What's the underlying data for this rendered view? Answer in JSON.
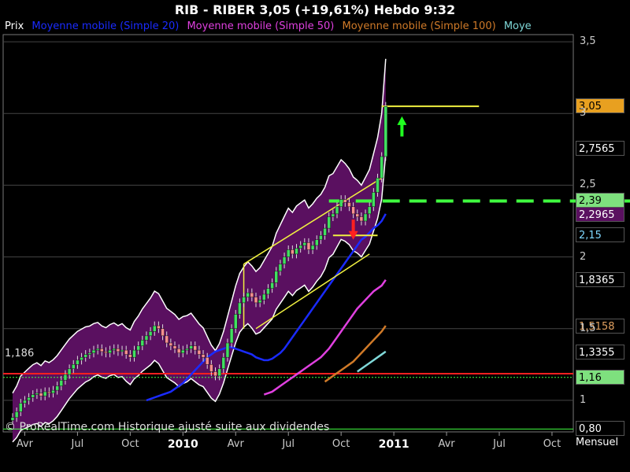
{
  "title": "RIB - RIBER     3,05 (+19,61%)     Hebdo  9:32",
  "legend": {
    "prix": "Prix",
    "ma20": "Moyenne mobile (Simple 20)",
    "ma50": "Moyenne mobile (Simple 50)",
    "ma100": "Moyenne mobile (Simple 100)",
    "ma200": "Moye"
  },
  "colors": {
    "ma20": "#1a2bff",
    "ma50": "#e040e0",
    "ma100": "#d07a28",
    "ma200": "#7fd8d8",
    "bollinger_fill": "#5a1060",
    "resistance": "#ff2020",
    "support": "#40ff40",
    "channel": "#f0f040",
    "bull_candle": "#40e060",
    "bear_candle": "#ff9090"
  },
  "price_tags": [
    {
      "label": "3,05",
      "bg": "#e8a020",
      "fg": "#000000",
      "value": 3.05
    },
    {
      "label": "2,7565",
      "bg": "#000000",
      "fg": "#ffffff",
      "value": 2.7565
    },
    {
      "label": "2,39",
      "bg": "#7ee07e",
      "fg": "#000000",
      "value": 2.39
    },
    {
      "label": "2,2965",
      "bg": "#5a1060",
      "fg": "#ffffff",
      "value": 2.2965
    },
    {
      "label": "2,15",
      "bg": "#000000",
      "fg": "#7fd8ff",
      "value": 2.15
    },
    {
      "label": "1,8365",
      "bg": "#000000",
      "fg": "#ffffff",
      "value": 1.8365
    },
    {
      "label": "1,5158",
      "bg": "#000000",
      "fg": "#e0a060",
      "value": 1.5158
    },
    {
      "label": "1,3355",
      "bg": "#000000",
      "fg": "#ffffff",
      "value": 1.3355
    },
    {
      "label": "1,16",
      "bg": "#7ee07e",
      "fg": "#000000",
      "value": 1.16
    },
    {
      "label": "0,80",
      "bg": "#000000",
      "fg": "#ffffff",
      "value": 0.8
    }
  ],
  "period_label": "Mensuel",
  "watermark": "© ProRealTime.com Historique ajusté suite aux dividendes",
  "level_1186": "1,186",
  "chart_data": {
    "type": "line",
    "ylim": [
      0.78,
      3.55
    ],
    "y_ticks": [
      {
        "label": "3,5",
        "value": 3.5
      },
      {
        "label": "3",
        "value": 3.0
      },
      {
        "label": "2,5",
        "value": 2.5
      },
      {
        "label": "2",
        "value": 2.0
      },
      {
        "label": "1,5",
        "value": 1.5
      },
      {
        "label": "1",
        "value": 1.0
      }
    ],
    "x_ticks": [
      {
        "label": "Avr",
        "week": 3,
        "year": false
      },
      {
        "label": "Jul",
        "week": 16,
        "year": false
      },
      {
        "label": "Oct",
        "week": 29,
        "year": false
      },
      {
        "label": "2010",
        "week": 42,
        "year": true
      },
      {
        "label": "Avr",
        "week": 55,
        "year": false
      },
      {
        "label": "Jul",
        "week": 68,
        "year": false
      },
      {
        "label": "Oct",
        "week": 81,
        "year": false
      },
      {
        "label": "2011",
        "week": 94,
        "year": true
      },
      {
        "label": "Avr",
        "week": 107,
        "year": false
      },
      {
        "label": "Jul",
        "week": 120,
        "year": false
      },
      {
        "label": "Oct",
        "week": 133,
        "year": false
      }
    ],
    "price_closes": [
      0.88,
      0.92,
      0.98,
      1.0,
      1.02,
      1.04,
      1.05,
      1.03,
      1.06,
      1.05,
      1.07,
      1.1,
      1.14,
      1.18,
      1.22,
      1.25,
      1.28,
      1.3,
      1.32,
      1.33,
      1.35,
      1.36,
      1.34,
      1.33,
      1.35,
      1.36,
      1.34,
      1.35,
      1.32,
      1.3,
      1.35,
      1.38,
      1.42,
      1.45,
      1.48,
      1.52,
      1.5,
      1.45,
      1.4,
      1.38,
      1.36,
      1.33,
      1.35,
      1.36,
      1.38,
      1.35,
      1.32,
      1.3,
      1.25,
      1.2,
      1.17,
      1.22,
      1.3,
      1.4,
      1.5,
      1.6,
      1.68,
      1.72,
      1.75,
      1.72,
      1.68,
      1.7,
      1.74,
      1.78,
      1.82,
      1.9,
      1.95,
      2.0,
      2.05,
      2.02,
      2.06,
      2.08,
      2.1,
      2.05,
      2.08,
      2.12,
      2.15,
      2.2,
      2.28,
      2.3,
      2.35,
      2.4,
      2.38,
      2.35,
      2.3,
      2.28,
      2.25,
      2.3,
      2.35,
      2.45,
      2.55,
      2.7,
      3.05
    ],
    "ma20": [
      1.0,
      1.01,
      1.02,
      1.03,
      1.04,
      1.05,
      1.06,
      1.08,
      1.1,
      1.12,
      1.15,
      1.18,
      1.21,
      1.24,
      1.27,
      1.3,
      1.32,
      1.34,
      1.35,
      1.36,
      1.37,
      1.37,
      1.36,
      1.35,
      1.34,
      1.33,
      1.32,
      1.3,
      1.29,
      1.28,
      1.28,
      1.29,
      1.31,
      1.33,
      1.36,
      1.4,
      1.44,
      1.48,
      1.52,
      1.56,
      1.6,
      1.64,
      1.68,
      1.72,
      1.76,
      1.8,
      1.84,
      1.88,
      1.92,
      1.96,
      2.0,
      2.04,
      2.08,
      2.12,
      2.14,
      2.17,
      2.2,
      2.22,
      2.25,
      2.3
    ],
    "ma20_start": 33,
    "ma50": [
      1.04,
      1.05,
      1.06,
      1.08,
      1.1,
      1.12,
      1.14,
      1.16,
      1.18,
      1.2,
      1.22,
      1.24,
      1.26,
      1.28,
      1.3,
      1.33,
      1.36,
      1.4,
      1.44,
      1.48,
      1.52,
      1.56,
      1.6,
      1.64,
      1.67,
      1.7,
      1.73,
      1.76,
      1.78,
      1.8,
      1.84
    ],
    "ma50_start": 62,
    "ma100": [
      1.13,
      1.15,
      1.17,
      1.19,
      1.21,
      1.23,
      1.25,
      1.27,
      1.3,
      1.33,
      1.36,
      1.39,
      1.42,
      1.45,
      1.48,
      1.52
    ],
    "ma100_start": 77,
    "ma200": [
      1.2,
      1.22,
      1.24,
      1.26,
      1.28,
      1.3,
      1.32,
      1.34
    ],
    "ma200_start": 85,
    "lines": {
      "resistance": 1.186,
      "support_lower": 1.16,
      "breakout_dashed": 2.39,
      "target": 3.05,
      "base": 0.8
    }
  }
}
